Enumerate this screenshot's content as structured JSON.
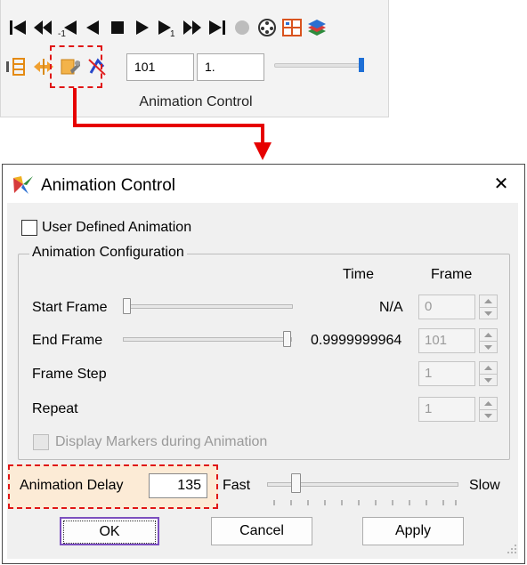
{
  "toolbar": {
    "playback_icons": [
      "skip-to-start-icon",
      "fast-rewind-icon",
      "step-back-icon",
      "play-reverse-icon",
      "stop-icon",
      "play-icon",
      "step-forward-icon",
      "fast-forward-icon",
      "skip-to-end-icon",
      "record-icon",
      "film-reel-icon",
      "grid-settings-icon",
      "layers-icon"
    ],
    "tool_icons": [
      "frame-range-icon",
      "move-icon",
      "animation-control-icon",
      "reset-icon"
    ],
    "frame_field": "101",
    "time_field": "1.",
    "caption": "Animation Control"
  },
  "dialog": {
    "title": "Animation Control",
    "close_glyph": "✕",
    "user_defined_label": "User Defined Animation",
    "group_title": "Animation Configuration",
    "col_time": "Time",
    "col_frame": "Frame",
    "rows": {
      "start": {
        "label": "Start Frame",
        "time": "N/A",
        "frame": "0"
      },
      "end": {
        "label": "End Frame",
        "time": "0.9999999964",
        "frame": "101"
      },
      "step": {
        "label": "Frame Step",
        "frame": "1"
      },
      "repeat": {
        "label": "Repeat",
        "frame": "1"
      }
    },
    "markers_label": "Display Markers during Animation",
    "delay_label": "Animation Delay",
    "delay_value": "135",
    "fast_label": "Fast",
    "slow_label": "Slow",
    "ok_label": "OK",
    "cancel_label": "Cancel",
    "apply_label": "Apply"
  },
  "colors": {
    "highlight": "#e01616",
    "accent_blue": "#1e6fd6",
    "highlight_fill": "#fcebd6"
  }
}
